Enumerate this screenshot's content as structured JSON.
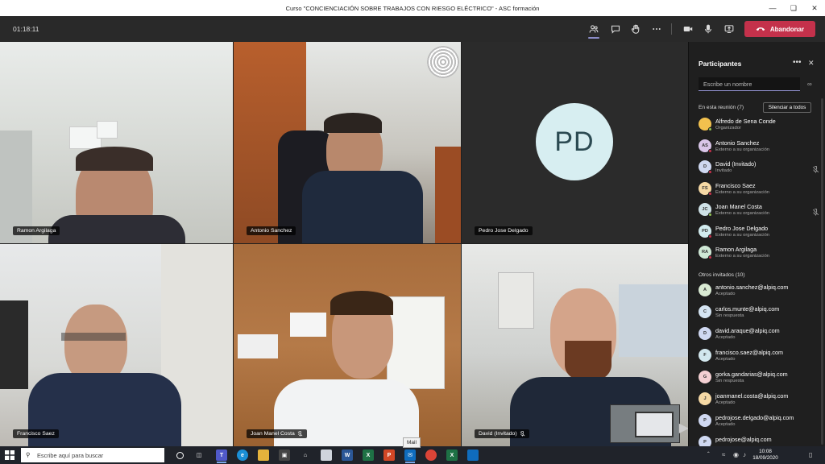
{
  "window": {
    "title": "Curso \"CONCIENCIACIÓN SOBRE TRABAJOS CON RIESGO ELÉCTRICO\" - ASC formación"
  },
  "toolbar": {
    "timer": "01:18:11",
    "leave_label": "Abandonar",
    "icons": [
      "people-icon",
      "chat-icon",
      "raise-hand-icon",
      "more-icon",
      "camera-icon",
      "mic-icon",
      "share-icon"
    ]
  },
  "videos": [
    {
      "name": "Ramon Argilaga"
    },
    {
      "name": "Antonio Sanchez"
    },
    {
      "name": "Pedro Jose Delgado",
      "initials": "PD"
    },
    {
      "name": "Francisco Saez"
    },
    {
      "name": "Joan Manel Costa"
    },
    {
      "name": "David (Invitado)"
    }
  ],
  "panel": {
    "title": "Participantes",
    "search_placeholder": "Escribe un nombre",
    "in_meeting_label": "En esta reunión (7)",
    "mute_all_label": "Silenciar a todos",
    "others_label": "Otros invitados (10)",
    "participants": [
      {
        "name": "Alfredo de Sena Conde",
        "sub": "Organizador",
        "initials": "",
        "color": "#f2c14e",
        "status": "#92c353",
        "muted": false
      },
      {
        "name": "Antonio Sanchez",
        "sub": "Externo a su organización",
        "initials": "AS",
        "color": "#d9c6e8",
        "status": "#c4314b",
        "muted": false
      },
      {
        "name": "David (Invitado)",
        "sub": "Invitado",
        "initials": "D",
        "color": "#cfd8f1",
        "status": "#c4314b",
        "muted": true
      },
      {
        "name": "Francisco Saez",
        "sub": "Externo a su organización",
        "initials": "FS",
        "color": "#f6d9a5",
        "status": "#c4314b",
        "muted": false
      },
      {
        "name": "Joan Manel Costa",
        "sub": "Externo a su organización",
        "initials": "JC",
        "color": "#cfe2e7",
        "status": "#92c353",
        "muted": true
      },
      {
        "name": "Pedro Jose Delgado",
        "sub": "Externo a su organización",
        "initials": "PD",
        "color": "#d2ecef",
        "status": "#c4314b",
        "muted": false
      },
      {
        "name": "Ramon Argilaga",
        "sub": "Externo a su organización",
        "initials": "RA",
        "color": "#cfe8d5",
        "status": "#c4314b",
        "muted": false
      }
    ],
    "invited": [
      {
        "name": "antonio.sanchez@alpiq.com",
        "sub": "Aceptado",
        "initials": "A",
        "color": "#d9ead3"
      },
      {
        "name": "carlos.munte@alpiq.com",
        "sub": "Sin respuesta",
        "initials": "C",
        "color": "#d4e4f2"
      },
      {
        "name": "david.araque@alpiq.com",
        "sub": "Aceptado",
        "initials": "D",
        "color": "#cfd8f1"
      },
      {
        "name": "francisco.saez@alpiq.com",
        "sub": "Aceptado",
        "initials": "F",
        "color": "#d2e7ee"
      },
      {
        "name": "gorka.gandarias@alpiq.com",
        "sub": "Sin respuesta",
        "initials": "G",
        "color": "#f4d0d3"
      },
      {
        "name": "joanmanel.costa@alpiq.com",
        "sub": "Aceptado",
        "initials": "J",
        "color": "#f6d9a5"
      },
      {
        "name": "pedrojose.delgado@alpiq.com",
        "sub": "Aceptado",
        "initials": "P",
        "color": "#cfd8f1"
      },
      {
        "name": "pedrojose@alpiq.com",
        "sub": "",
        "initials": "P",
        "color": "#cfd8f1"
      }
    ]
  },
  "taskbar": {
    "search_placeholder": "Escribe aquí para buscar",
    "tooltip": "Mail",
    "time": "10:08",
    "date": "18/09/2020"
  }
}
